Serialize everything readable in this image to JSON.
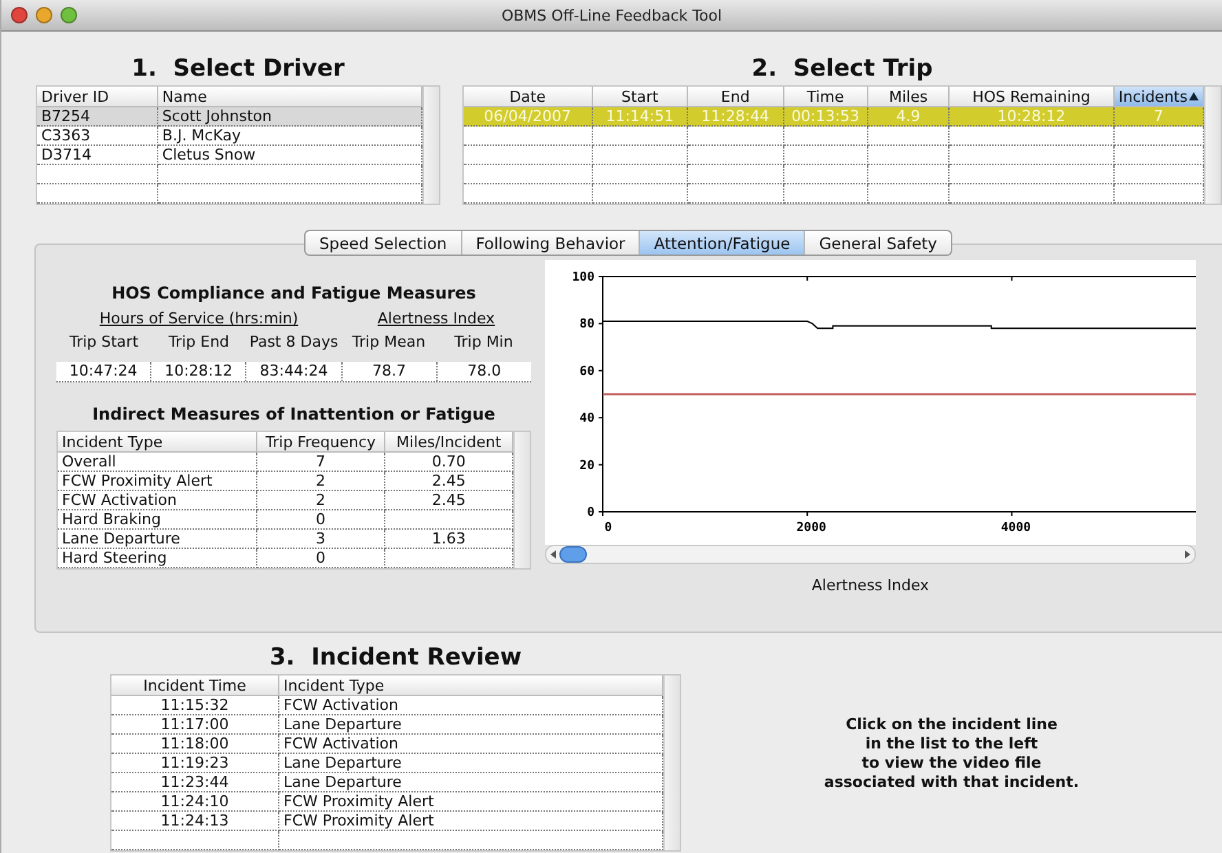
{
  "window": {
    "title": "OBMS Off-Line Feedback Tool"
  },
  "driver_section": {
    "title": "1.  Select Driver",
    "columns": [
      {
        "label": "Driver ID",
        "sorted": false
      },
      {
        "label": "Name",
        "sorted": false
      }
    ],
    "rows": [
      {
        "cells": [
          "B7254",
          "Scott Johnston"
        ],
        "selected": true
      },
      {
        "cells": [
          "C3363",
          "B.J. McKay"
        ],
        "selected": false
      },
      {
        "cells": [
          "D3714",
          "Cletus Snow"
        ],
        "selected": false
      }
    ]
  },
  "trip_section": {
    "title": "2.  Select Trip",
    "columns": [
      {
        "label": "Date",
        "sorted": false
      },
      {
        "label": "Start",
        "sorted": false
      },
      {
        "label": "End",
        "sorted": false
      },
      {
        "label": "Time",
        "sorted": false
      },
      {
        "label": "Miles",
        "sorted": false
      },
      {
        "label": "HOS Remaining",
        "sorted": false
      },
      {
        "label": "Incidents",
        "sorted": true
      }
    ],
    "rows": [
      {
        "cells": [
          "06/04/2007",
          "11:14:51",
          "11:28:44",
          "00:13:53",
          "4.9",
          "10:28:12",
          "7"
        ],
        "selected": true
      }
    ]
  },
  "tabs": [
    {
      "label": "Speed Selection",
      "selected": false
    },
    {
      "label": "Following Behavior",
      "selected": false
    },
    {
      "label": "Attention/Fatigue",
      "selected": true
    },
    {
      "label": "General Safety",
      "selected": false
    }
  ],
  "hos": {
    "title": "HOS Compliance and Fatigue Measures",
    "groups": [
      {
        "label": "Hours of Service (hrs:min)"
      },
      {
        "label": "Alertness Index"
      }
    ],
    "columns": [
      "Trip Start",
      "Trip End",
      "Past 8 Days",
      "Trip Mean",
      "Trip Min"
    ],
    "values": [
      "10:47:24",
      "10:28:12",
      "83:44:24",
      "78.7",
      "78.0"
    ]
  },
  "indirect": {
    "title": "Indirect Measures of Inattention or Fatigue",
    "columns": [
      {
        "label": "Incident Type",
        "sorted": false
      },
      {
        "label": "Trip Frequency",
        "sorted": false
      },
      {
        "label": "Miles/Incident",
        "sorted": false
      }
    ],
    "rows": [
      {
        "cells": [
          "Overall",
          "7",
          "0.70"
        ]
      },
      {
        "cells": [
          "FCW Proximity Alert",
          "2",
          "2.45"
        ]
      },
      {
        "cells": [
          "FCW Activation",
          "2",
          "2.45"
        ]
      },
      {
        "cells": [
          "Hard Braking",
          "0",
          ""
        ]
      },
      {
        "cells": [
          "Lane Departure",
          "3",
          "1.63"
        ]
      },
      {
        "cells": [
          "Hard Steering",
          "0",
          ""
        ]
      }
    ]
  },
  "alertness_chart": {
    "caption": "Alertness Index",
    "chart_data": {
      "type": "line",
      "x": [
        0,
        2000,
        2050,
        2100,
        2250,
        2250,
        3800,
        3800,
        5800
      ],
      "series": [
        {
          "color": "#000000",
          "values": [
            81,
            81,
            80,
            78,
            78,
            79,
            79,
            78,
            78
          ]
        },
        {
          "color": "#c06060",
          "values": [
            50,
            50,
            50,
            50,
            50,
            50,
            50,
            50,
            50
          ]
        }
      ],
      "xlim": [
        0,
        5800
      ],
      "ylim": [
        0,
        100
      ],
      "xticks": [
        0,
        2000,
        4000
      ],
      "yticks": [
        0,
        20,
        40,
        60,
        80,
        100
      ]
    }
  },
  "incident_section": {
    "title": "3.  Incident Review",
    "columns": [
      {
        "label": "Incident Time",
        "sorted": false
      },
      {
        "label": "Incident Type",
        "sorted": false
      }
    ],
    "rows": [
      {
        "cells": [
          "11:15:32",
          "FCW Activation"
        ],
        "selected": false
      },
      {
        "cells": [
          "11:17:00",
          "Lane Departure"
        ],
        "selected": false
      },
      {
        "cells": [
          "11:18:00",
          "FCW Activation"
        ],
        "selected": false
      },
      {
        "cells": [
          "11:19:23",
          "Lane Departure"
        ],
        "selected": false
      },
      {
        "cells": [
          "11:23:44",
          "Lane Departure"
        ],
        "selected": false
      },
      {
        "cells": [
          "11:24:10",
          "FCW Proximity Alert"
        ],
        "selected": false
      },
      {
        "cells": [
          "11:24:13",
          "FCW Proximity Alert"
        ],
        "selected": false
      }
    ]
  },
  "instruction": {
    "lines": [
      "Click on the incident line",
      "in the list to the left",
      "to view the video file",
      "associated with that incident."
    ]
  }
}
